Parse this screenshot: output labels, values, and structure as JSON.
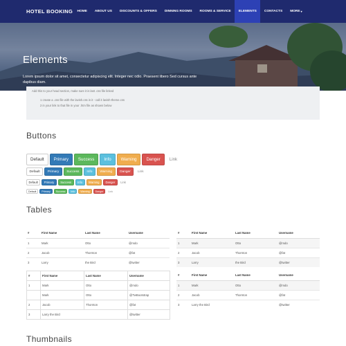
{
  "navbar": {
    "brand": "HOTEL BOOKING",
    "items": [
      "HOME",
      "ABOUT US",
      "DISCOUNTS & OFFERS",
      "DINNING ROOMS",
      "ROOMS & SERVICE",
      "ELEMENTS",
      "CONTACTS",
      "MORE"
    ],
    "active": "ELEMENTS",
    "more_caret": "▾"
  },
  "hero": {
    "title": "Elements",
    "text": "Lorem ipsum dolor sit amet, consectetur adipiscing elit. Integer nec odio. Praesent libero Sed cursus ante dapibus diam."
  },
  "info_box": {
    "line1": "Add this to your head section, make sure it is last .css file linked",
    "line2": "1 create a .css file with the lavish.css in it - call it lavish-theme.css",
    "line3": "2 in your link to that file in your .htm file as shown below"
  },
  "sections": {
    "buttons": "Buttons",
    "tables": "Tables",
    "thumbnails": "Thumbnails"
  },
  "buttons": [
    "Default",
    "Primary",
    "Success",
    "Info",
    "Warning",
    "Danger",
    "Link"
  ],
  "table": {
    "headers": [
      "#",
      "First Name",
      "Last Name",
      "Username"
    ],
    "rows": [
      [
        "1",
        "Mark",
        "Otto",
        "@mdo"
      ],
      [
        "2",
        "Jacob",
        "Thornton",
        "@fat"
      ],
      [
        "3",
        "Larry",
        "the Bird",
        "@twitter"
      ]
    ]
  },
  "table_bordered": {
    "rows": [
      [
        "1",
        "Mark",
        "Otto",
        "@mdo"
      ],
      [
        "",
        "Mark",
        "Otto",
        "@TwBootstrap"
      ],
      [
        "2",
        "Jacob",
        "Thornton",
        "@fat"
      ],
      [
        "3",
        "Larry the Bird",
        "",
        "@twitter"
      ]
    ]
  },
  "table_hover": {
    "rows": [
      [
        "1",
        "Mark",
        "Otto",
        "@mdo"
      ],
      [
        "2",
        "Jacob",
        "Thornton",
        "@fat"
      ],
      [
        "3",
        "Larry the Bird",
        "",
        "@twitter"
      ]
    ]
  }
}
